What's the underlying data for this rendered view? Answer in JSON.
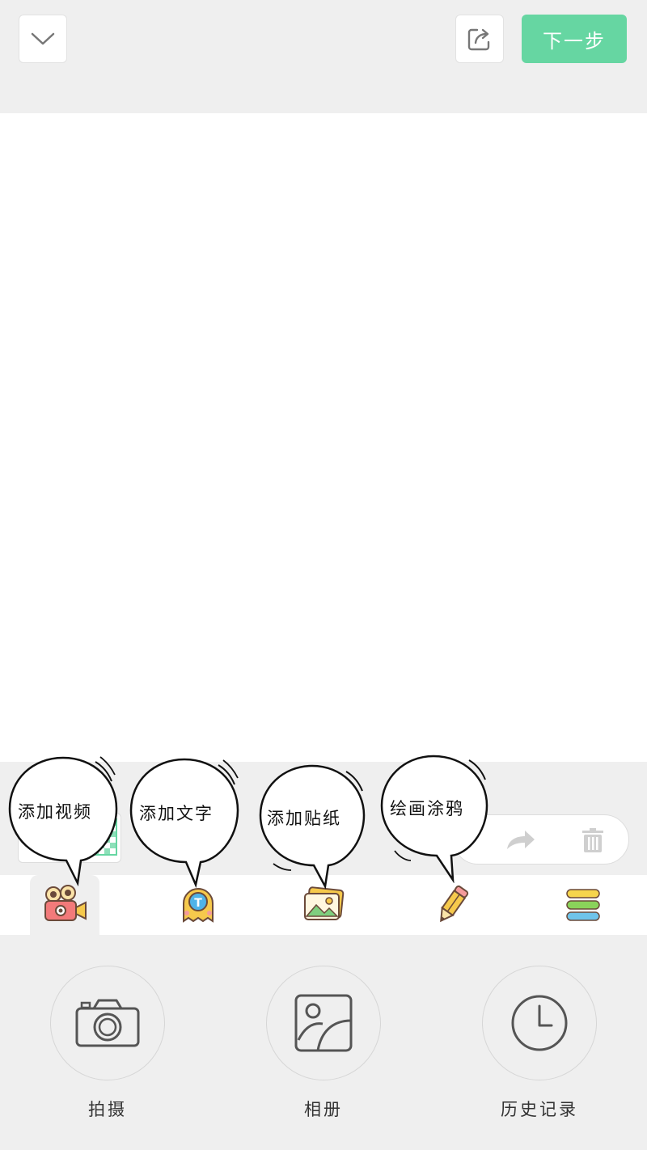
{
  "header": {
    "collapse_icon": "chevron-down-icon",
    "share_icon": "share-icon",
    "next_label": "下一步",
    "accent_color": "#66d6a2"
  },
  "strip": {
    "thumbnail_icon": "checkerboard-thumbnail",
    "redo_icon": "redo-arrow-icon",
    "delete_icon": "trash-icon"
  },
  "tools": [
    {
      "icon": "video-camera-icon",
      "callout": "添加视频",
      "active": true
    },
    {
      "icon": "text-ghost-icon",
      "callout": "添加文字",
      "active": false
    },
    {
      "icon": "sticker-image-icon",
      "callout": "添加贴纸",
      "active": false
    },
    {
      "icon": "pencil-icon",
      "callout": "绘画涂鸦",
      "active": false
    },
    {
      "icon": "layers-icon",
      "active": false
    }
  ],
  "panel": {
    "buttons": [
      {
        "icon": "camera-icon",
        "label": "拍摄"
      },
      {
        "icon": "album-icon",
        "label": "相册"
      },
      {
        "icon": "clock-icon",
        "label": "历史记录"
      }
    ]
  }
}
